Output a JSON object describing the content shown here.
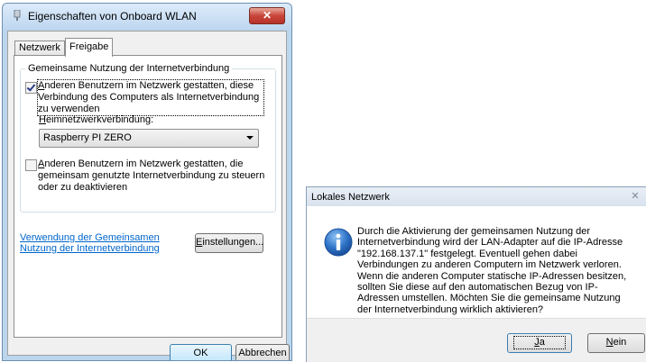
{
  "props_window": {
    "title": "Eigenschaften von Onboard WLAN",
    "close_glyph": "✕",
    "tabs": [
      {
        "label": "Netzwerk"
      },
      {
        "label": "Freigabe"
      }
    ],
    "group_title": "Gemeinsame Nutzung der Internetverbindung",
    "allow_share": {
      "checked": true,
      "underlined_char": "A",
      "label_rest": "nderen Benutzern im Netzwerk gestatten, diese Verbindung des Computers als Internetverbindung zu verwenden"
    },
    "home_network": {
      "underlined_char": "H",
      "label_rest": "eimnetzwerkverbindung:",
      "selected": "Raspberry PI ZERO"
    },
    "allow_control": {
      "checked": false,
      "underlined_char": "A",
      "label_rest": "nderen Benutzern im Netzwerk gestatten, die gemeinsam genutzte Internetverbindung zu steuern oder zu deaktivieren"
    },
    "help_link": "Verwendung der Gemeinsamen Nutzung der Internetverbindung",
    "settings_button": {
      "underlined_char": "E",
      "label_rest": "instellungen..."
    },
    "ok_button": "OK",
    "cancel_button": "Abbrechen"
  },
  "message_box": {
    "title": "Lokales Netzwerk",
    "close_glyph": "✕",
    "icon": "info-icon",
    "message": "Durch die Aktivierung der gemeinsamen Nutzung der Internetverbindung wird der LAN-Adapter auf die IP-Adresse \"192.168.137.1\" festgelegt. Eventuell gehen dabei Verbindungen zu anderen Computern im Netzwerk verloren. Wenn die anderen Computer statische IP-Adressen besitzen, sollten Sie diese auf den automatischen Bezug von IP-Adressen umstellen. Möchten Sie die gemeinsame Nutzung der Internetverbindung wirklich aktivieren?",
    "yes_button": {
      "underlined_char": "J",
      "label_rest": "a"
    },
    "no_button": {
      "underlined_char": "N",
      "label_rest": "ein"
    }
  }
}
